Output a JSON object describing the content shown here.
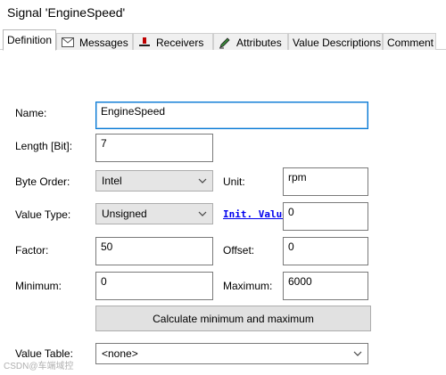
{
  "window": {
    "title": "Signal 'EngineSpeed'"
  },
  "tabs": [
    {
      "label": "Definition",
      "icon": "none"
    },
    {
      "label": "Messages",
      "icon": "envelope-icon"
    },
    {
      "label": "Receivers",
      "icon": "receiver-icon"
    },
    {
      "label": "Attributes",
      "icon": "pencil-icon"
    },
    {
      "label": "Value Descriptions",
      "icon": "none"
    },
    {
      "label": "Comment",
      "icon": "none"
    }
  ],
  "active_tab": "Definition",
  "form": {
    "name_label": "Name:",
    "name_value": "EngineSpeed",
    "length_label": "Length [Bit]:",
    "length_value": "7",
    "byte_order_label": "Byte Order:",
    "byte_order_value": "Intel",
    "unit_label": "Unit:",
    "unit_value": "rpm",
    "value_type_label": "Value Type:",
    "value_type_value": "Unsigned",
    "init_value_label": "Init. Value",
    "init_value": "0",
    "factor_label": "Factor:",
    "factor_value": "50",
    "offset_label": "Offset:",
    "offset_value": "0",
    "minimum_label": "Minimum:",
    "minimum_value": "0",
    "maximum_label": "Maximum:",
    "maximum_value": "6000",
    "calc_button_label": "Calculate minimum and maximum",
    "value_table_label": "Value Table:",
    "value_table_value": "<none>"
  },
  "watermark": "CSDN@车端域控",
  "colors": {
    "focus_border": "#0078d7",
    "link": "#0000ee"
  }
}
